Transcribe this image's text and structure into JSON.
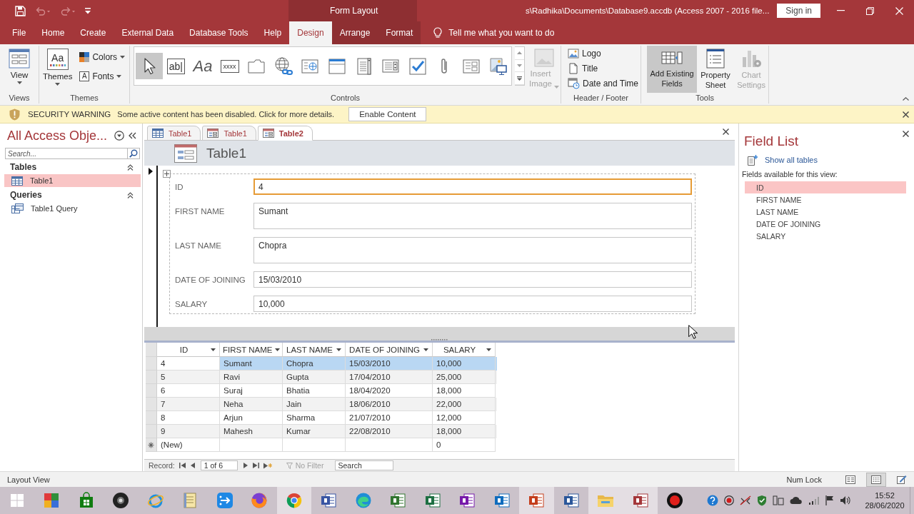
{
  "title_bar": {
    "quick_access": [
      {
        "kind": "save",
        "disabled": false
      },
      {
        "kind": "undo",
        "disabled": true
      },
      {
        "kind": "redo",
        "disabled": true
      },
      {
        "kind": "customize",
        "disabled": false
      }
    ],
    "contextual_label": "Form Layout",
    "title": "s\\Radhika\\Documents\\Database9.accdb (Access 2007 - 2016 file...",
    "sign_in": "Sign in"
  },
  "menu_tabs": [
    {
      "label": "File",
      "selected": false,
      "contextual": false
    },
    {
      "label": "Home",
      "selected": false,
      "contextual": false
    },
    {
      "label": "Create",
      "selected": false,
      "contextual": false
    },
    {
      "label": "External Data",
      "selected": false,
      "contextual": false
    },
    {
      "label": "Database Tools",
      "selected": false,
      "contextual": false
    },
    {
      "label": "Help",
      "selected": false,
      "contextual": false
    },
    {
      "label": "Design",
      "selected": true,
      "contextual": true
    },
    {
      "label": "Arrange",
      "selected": false,
      "contextual": true
    },
    {
      "label": "Format",
      "selected": false,
      "contextual": true
    }
  ],
  "tell_me": {
    "placeholder": "Tell me what you want to do"
  },
  "ribbon": {
    "views": {
      "label": "Views",
      "button": "View"
    },
    "themes": {
      "label": "Themes",
      "button": "Themes",
      "glyph": "Aa",
      "options": [
        {
          "kind": "colors",
          "label": "Colors"
        },
        {
          "kind": "fonts",
          "label": "Fonts",
          "glyph": "A"
        }
      ]
    },
    "controls": {
      "label": "Controls",
      "gallery": [
        {
          "kind": "pointer",
          "selected": true
        },
        {
          "kind": "textbox",
          "glyph": "ab|",
          "selected": false
        },
        {
          "kind": "label",
          "glyph": "Aa",
          "selected": false
        },
        {
          "kind": "button",
          "glyph": "xxxx",
          "selected": false
        },
        {
          "kind": "tab",
          "selected": false
        },
        {
          "kind": "hyperlink",
          "selected": false
        },
        {
          "kind": "browser",
          "selected": false
        },
        {
          "kind": "navigation",
          "selected": false
        },
        {
          "kind": "combo",
          "selected": false
        },
        {
          "kind": "list",
          "selected": false
        },
        {
          "kind": "checkbox",
          "selected": false
        },
        {
          "kind": "attachment",
          "selected": false
        },
        {
          "kind": "option_group",
          "selected": false
        },
        {
          "kind": "image",
          "selected": false
        }
      ],
      "insert_image": {
        "label": "Insert Image",
        "disabled": true
      }
    },
    "header_footer": {
      "label": "Header / Footer",
      "items": [
        {
          "kind": "logo",
          "label": "Logo"
        },
        {
          "kind": "title",
          "label": "Title"
        },
        {
          "kind": "date_time",
          "label": "Date and Time"
        }
      ]
    },
    "tools": {
      "label": "Tools",
      "buttons": [
        {
          "kind": "add_fields",
          "label": "Add Existing Fields",
          "selected": true,
          "disabled": false
        },
        {
          "kind": "property_sheet",
          "label": "Property Sheet",
          "selected": false,
          "disabled": false
        },
        {
          "kind": "chart_settings",
          "label": "Chart Settings",
          "selected": false,
          "disabled": true
        }
      ]
    }
  },
  "security_bar": {
    "title": "SECURITY WARNING",
    "message": "Some active content has been disabled. Click for more details.",
    "button": "Enable Content"
  },
  "nav_pane": {
    "title": "All Access Obje...",
    "search_placeholder": "Search...",
    "groups": [
      {
        "label": "Tables",
        "expanded": true,
        "items": [
          {
            "kind": "table",
            "label": "Table1",
            "selected": true
          }
        ]
      },
      {
        "label": "Queries",
        "expanded": true,
        "items": [
          {
            "kind": "query",
            "label": "Table1 Query",
            "selected": false
          }
        ]
      }
    ]
  },
  "document_tabs": [
    {
      "kind": "table",
      "label": "Table1",
      "selected": false
    },
    {
      "kind": "form",
      "label": "Table1",
      "selected": false
    },
    {
      "kind": "form",
      "label": "Table2",
      "selected": true
    }
  ],
  "form": {
    "title": "Table1",
    "fields": [
      {
        "label": "ID",
        "value": "4",
        "kind": "single_line",
        "focused": true
      },
      {
        "label": "FIRST NAME",
        "value": "Sumant",
        "kind": "multi_line",
        "focused": false
      },
      {
        "label": "LAST NAME",
        "value": "Chopra",
        "kind": "multi_line",
        "focused": false
      },
      {
        "label": "DATE OF JOINING",
        "value": "15/03/2010",
        "kind": "single_line",
        "focused": false
      },
      {
        "label": "SALARY",
        "value": "10,000",
        "kind": "single_line",
        "focused": false
      }
    ]
  },
  "datasheet": {
    "columns": [
      "ID",
      "FIRST NAME",
      "LAST NAME",
      "DATE OF JOINING",
      "SALARY"
    ],
    "rows": [
      {
        "cells": [
          "4",
          "Sumant",
          "Chopra",
          "15/03/2010",
          "10,000"
        ],
        "selected": true
      },
      {
        "cells": [
          "5",
          "Ravi",
          "Gupta",
          "17/04/2010",
          "25,000"
        ],
        "selected": false
      },
      {
        "cells": [
          "6",
          "Suraj",
          "Bhatia",
          "18/04/2020",
          "18,000"
        ],
        "selected": false
      },
      {
        "cells": [
          "7",
          "Neha",
          "Jain",
          "18/06/2010",
          "22,000"
        ],
        "selected": false
      },
      {
        "cells": [
          "8",
          "Arjun",
          "Sharma",
          "21/07/2010",
          "12,000"
        ],
        "selected": false
      },
      {
        "cells": [
          "9",
          "Mahesh",
          "Kumar",
          "22/08/2010",
          "18,000"
        ],
        "selected": false
      }
    ],
    "new_row": {
      "id": "(New)",
      "salary": "0"
    }
  },
  "record_navigator": {
    "label": "Record:",
    "position": "1 of 6",
    "filter": "No Filter",
    "filtered": false,
    "search_placeholder": "Search"
  },
  "field_list": {
    "title": "Field List",
    "link": "Show all tables",
    "caption": "Fields available for this view:",
    "fields": [
      {
        "label": "ID",
        "selected": true
      },
      {
        "label": "FIRST NAME",
        "selected": false
      },
      {
        "label": "LAST NAME",
        "selected": false
      },
      {
        "label": "DATE OF JOINING",
        "selected": false
      },
      {
        "label": "SALARY",
        "selected": false
      }
    ]
  },
  "status_bar": {
    "mode": "Layout View",
    "indicators": [
      "Num Lock"
    ],
    "views": [
      {
        "kind": "form",
        "selected": false
      },
      {
        "kind": "layout",
        "selected": true
      },
      {
        "kind": "design",
        "selected": false
      }
    ]
  },
  "taskbar": {
    "apps": [
      {
        "kind": "blocks",
        "active": false
      },
      {
        "kind": "store",
        "active": false
      },
      {
        "kind": "webcam",
        "active": false
      },
      {
        "kind": "orbit",
        "active": false
      },
      {
        "kind": "notebook",
        "active": false
      },
      {
        "kind": "share",
        "active": false
      },
      {
        "kind": "flame",
        "active": false
      },
      {
        "kind": "wheel",
        "active": true
      },
      {
        "kind": "visio",
        "active": false
      },
      {
        "kind": "wave",
        "active": false
      },
      {
        "kind": "project",
        "active": false
      },
      {
        "kind": "excel",
        "active": false
      },
      {
        "kind": "onenote",
        "active": false
      },
      {
        "kind": "outlook",
        "active": false
      },
      {
        "kind": "powerpoint",
        "active": true
      },
      {
        "kind": "word",
        "active": false
      },
      {
        "kind": "explorer",
        "active": true
      },
      {
        "kind": "access",
        "active": true
      },
      {
        "kind": "recorder",
        "active": false
      }
    ],
    "time": "15:52",
    "date": "28/06/2020"
  }
}
